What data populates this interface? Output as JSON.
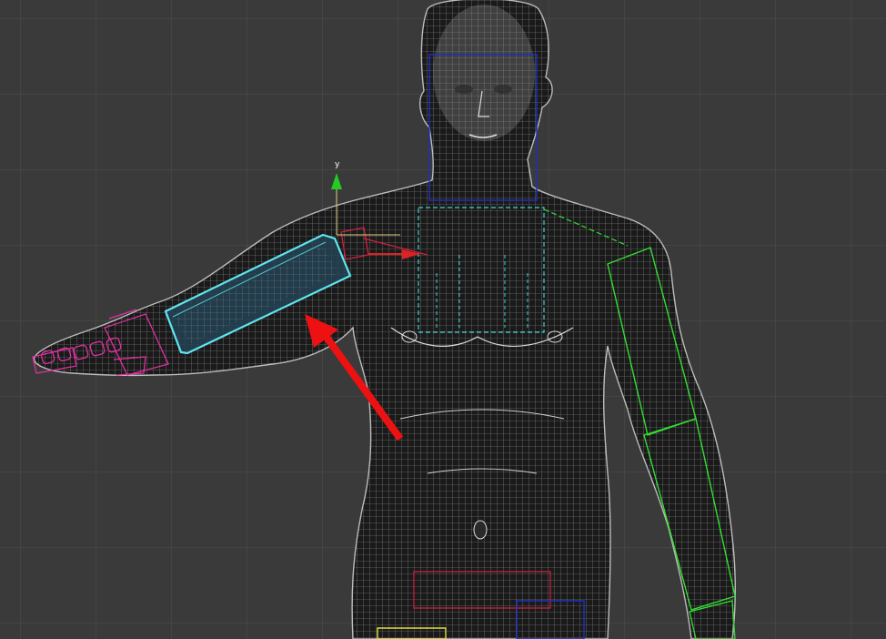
{
  "viewport": {
    "background": "#3a3a3a",
    "grid_color": "#4d4d4d",
    "mesh_color": "#cfcfcf",
    "axis_y_label": "y"
  },
  "rig": {
    "selected_bone": {
      "name": "",
      "color": "#5fe6f0"
    },
    "bone_colors": {
      "left_hand": "#e030a0",
      "right_arm": "#33dd33",
      "spine_neck": "#40d0d0",
      "head": "#2030c0",
      "clavicle": "#d02040",
      "pelvis": "#d02040",
      "leg": "#e0e040"
    }
  },
  "annotation": {
    "arrow_color": "#ee1111"
  },
  "gizmo": {
    "y_color": "#22cc22",
    "x_color": "#dd2222"
  }
}
